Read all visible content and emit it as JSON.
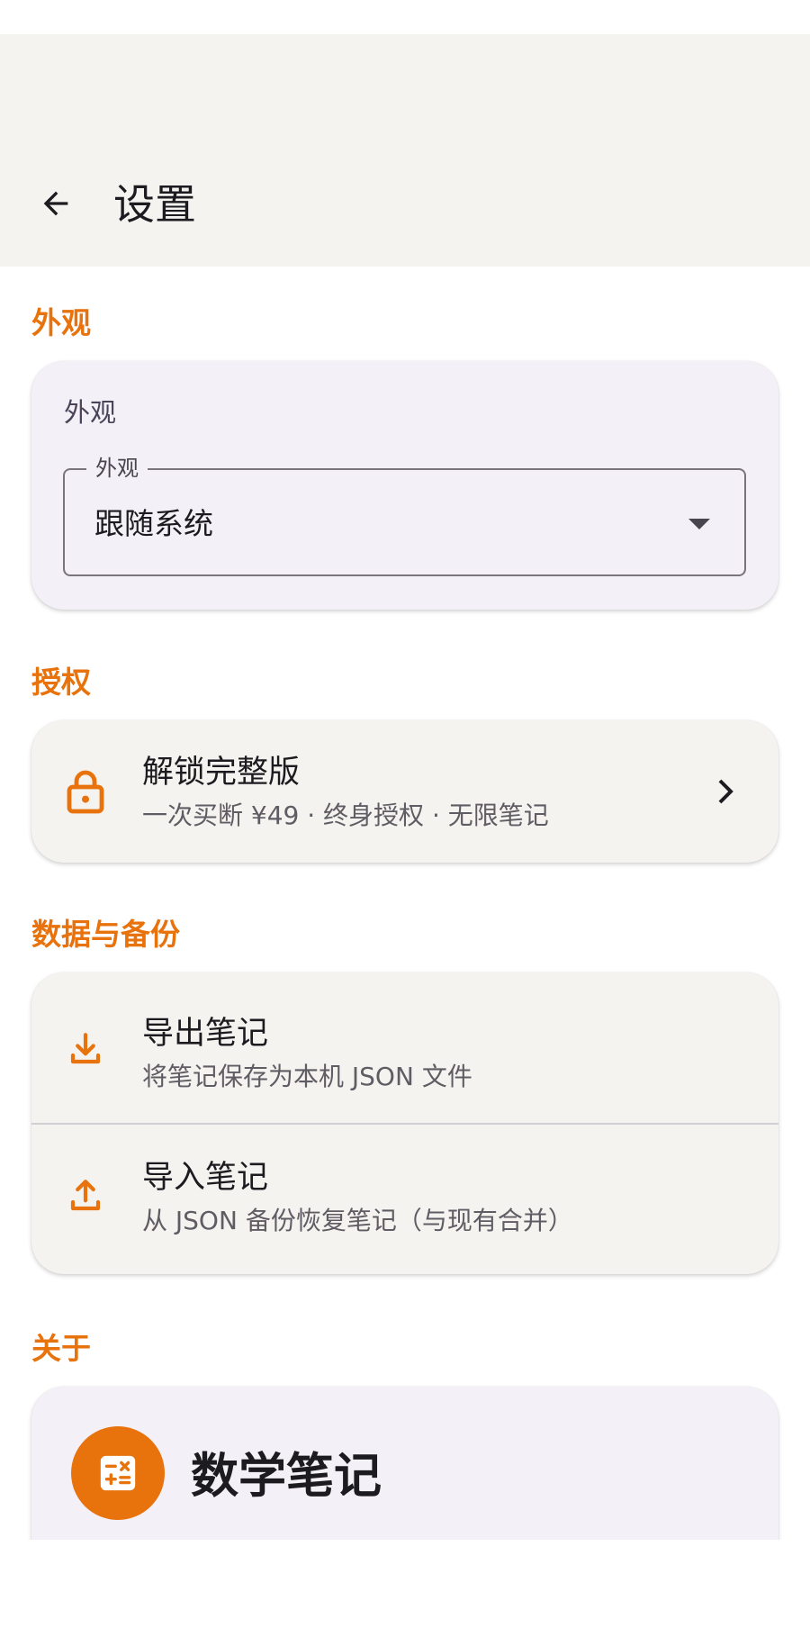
{
  "app_bar": {
    "title": "设置",
    "back_icon": "arrow-back-icon"
  },
  "appearance": {
    "section_title": "外观",
    "card_label": "外观",
    "dropdown_legend": "外观",
    "dropdown_value": "跟随系统"
  },
  "license": {
    "section_title": "授权",
    "item": {
      "icon": "lock-icon",
      "title": "解锁完整版",
      "subtitle": "一次买断 ¥49 · 终身授权 · 无限笔记"
    }
  },
  "data_backup": {
    "section_title": "数据与备份",
    "items": [
      {
        "icon": "download-icon",
        "title": "导出笔记",
        "subtitle": "将笔记保存为本机 JSON 文件"
      },
      {
        "icon": "upload-icon",
        "title": "导入笔记",
        "subtitle": "从 JSON 备份恢复笔记（与现有合并）"
      }
    ]
  },
  "about": {
    "section_title": "关于",
    "app_name": "数学笔记",
    "logo_icon": "calculator-icon"
  },
  "colors": {
    "accent": "#e8720c",
    "app_bar_bg": "#f5f3f0",
    "card_lavender": "#f4f0f7",
    "card_warm": "#f5f3f0"
  }
}
